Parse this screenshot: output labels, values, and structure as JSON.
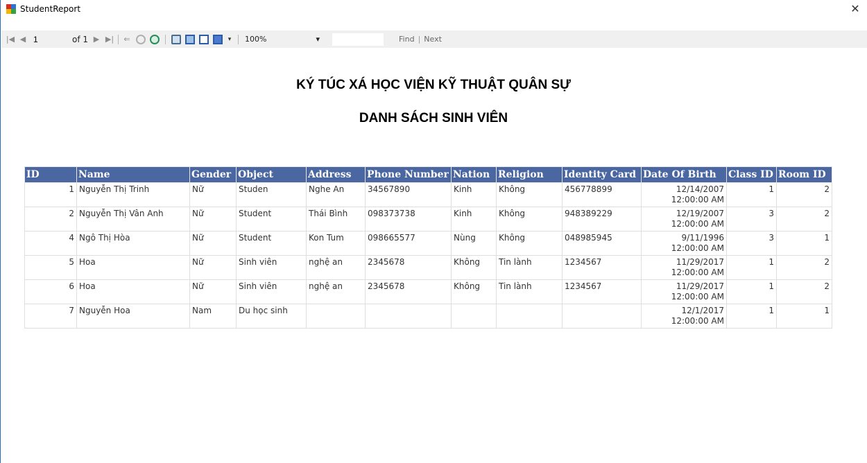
{
  "window": {
    "title": "StudentReport",
    "close_glyph": "✕"
  },
  "toolbar": {
    "first_glyph": "|◀",
    "prev_glyph": "◀",
    "current_page": "1",
    "of_label": "of 1",
    "next_glyph": "▶",
    "last_glyph": "▶|",
    "back_glyph": "⇐",
    "zoom": "100%",
    "zoom_arrow": "▾",
    "find_label": "Find",
    "separator": "|",
    "next_label": "Next"
  },
  "report": {
    "heading": "KÝ TÚC XÁ HỌC VIỆN KỸ THUẬT QUÂN SỰ",
    "subheading": "DANH SÁCH SINH VIÊN",
    "columns": [
      "ID",
      "Name",
      "Gender",
      "Object",
      "Address",
      "Phone Number",
      "Nation",
      "Religion",
      "Identity Card",
      "Date Of Birth",
      "Class ID",
      "Room ID"
    ],
    "rows": [
      {
        "id": "1",
        "name": "Nguyễn Thị Trinh",
        "gender": "Nữ",
        "object": "Studen",
        "address": "Nghe An",
        "phone": "34567890",
        "nation": "Kinh",
        "religion": "Không",
        "identity": "456778899",
        "dob_date": "12/14/2007",
        "dob_time": "12:00:00 AM",
        "class_id": "1",
        "room_id": "2"
      },
      {
        "id": "2",
        "name": "Nguyễn Thị Vân Anh",
        "gender": "Nữ",
        "object": "Student",
        "address": "Thái Bình",
        "phone": "098373738",
        "nation": "Kinh",
        "religion": "Không",
        "identity": "948389229",
        "dob_date": "12/19/2007",
        "dob_time": "12:00:00 AM",
        "class_id": "3",
        "room_id": "2"
      },
      {
        "id": "4",
        "name": "Ngô Thị Hòa",
        "gender": "Nữ",
        "object": "Student",
        "address": "Kon Tum",
        "phone": "098665577",
        "nation": "Nùng",
        "religion": "Không",
        "identity": "048985945",
        "dob_date": "9/11/1996",
        "dob_time": "12:00:00 AM",
        "class_id": "3",
        "room_id": "1"
      },
      {
        "id": "5",
        "name": "Hoa",
        "gender": "Nữ",
        "object": "Sinh viên",
        "address": "nghệ an",
        "phone": "2345678",
        "nation": "Không",
        "religion": "Tin lành",
        "identity": "1234567",
        "dob_date": "11/29/2017",
        "dob_time": "12:00:00 AM",
        "class_id": "1",
        "room_id": "2"
      },
      {
        "id": "6",
        "name": "Hoa",
        "gender": "Nữ",
        "object": "Sinh viên",
        "address": "nghệ an",
        "phone": "2345678",
        "nation": "Không",
        "religion": "Tin lành",
        "identity": "1234567",
        "dob_date": "11/29/2017",
        "dob_time": "12:00:00 AM",
        "class_id": "1",
        "room_id": "2"
      },
      {
        "id": "7",
        "name": "Nguyễn Hoa",
        "gender": "Nam",
        "object": "Du học sinh",
        "address": "",
        "phone": "",
        "nation": "",
        "religion": "",
        "identity": "",
        "dob_date": "12/1/2017",
        "dob_time": "12:00:00 AM",
        "class_id": "1",
        "room_id": "1"
      }
    ]
  }
}
